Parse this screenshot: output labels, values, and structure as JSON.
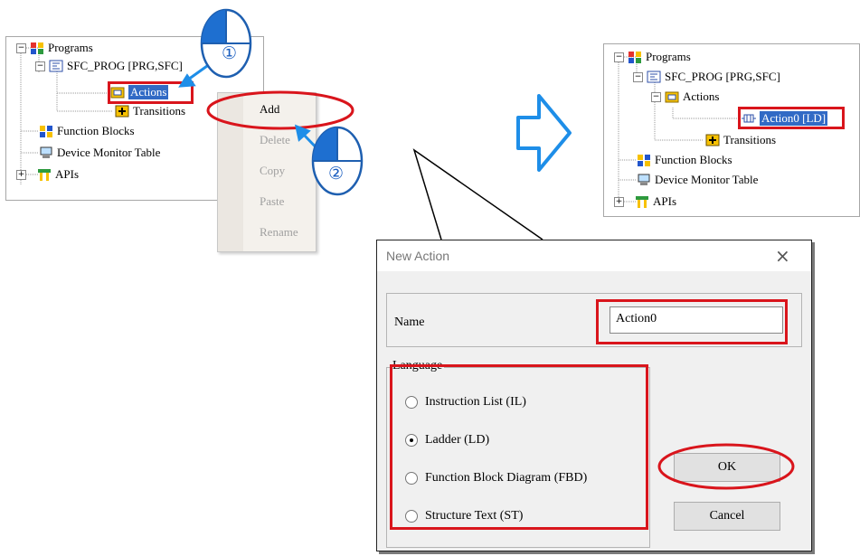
{
  "left_tree": {
    "programs": "Programs",
    "sfc_prog": "SFC_PROG [PRG,SFC]",
    "actions": "Actions",
    "transitions": "Transitions",
    "function_blocks": "Function Blocks",
    "device_monitor_table": "Device Monitor Table",
    "apis": "APIs"
  },
  "context_menu": {
    "add": "Add",
    "delete": "Delete",
    "copy": "Copy",
    "paste": "Paste",
    "rename": "Rename"
  },
  "steps": {
    "step1": "①",
    "step2": "②"
  },
  "right_tree": {
    "programs": "Programs",
    "sfc_prog": "SFC_PROG [PRG,SFC]",
    "actions": "Actions",
    "action0": "Action0 [LD]",
    "transitions": "Transitions",
    "function_blocks": "Function Blocks",
    "device_monitor_table": "Device Monitor Table",
    "apis": "APIs"
  },
  "dialog": {
    "title": "New Action",
    "close": "×",
    "name_label": "Name",
    "name_value": "Action0",
    "language_label": "Language",
    "options": [
      "Instruction List (IL)",
      "Ladder (LD)",
      "Function Block Diagram (FBD)",
      "Structure Text (ST)"
    ],
    "selected_option_index": 1,
    "ok": "OK",
    "cancel": "Cancel"
  },
  "colors": {
    "highlight_red": "#d9151c",
    "arrow_blue": "#1e8ee8",
    "selection_blue": "#316ac5"
  }
}
